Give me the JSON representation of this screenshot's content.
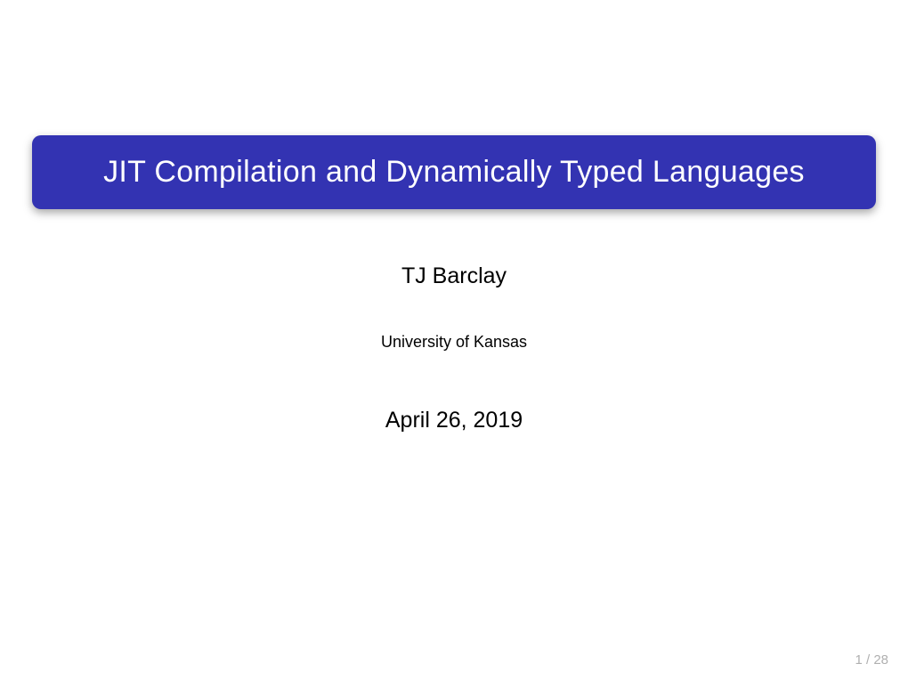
{
  "slide": {
    "title": "JIT Compilation and Dynamically Typed Languages",
    "author": "TJ Barclay",
    "affiliation": "University of Kansas",
    "date": "April 26, 2019",
    "page_current": "1",
    "page_total": "28",
    "page_separator": " / "
  }
}
